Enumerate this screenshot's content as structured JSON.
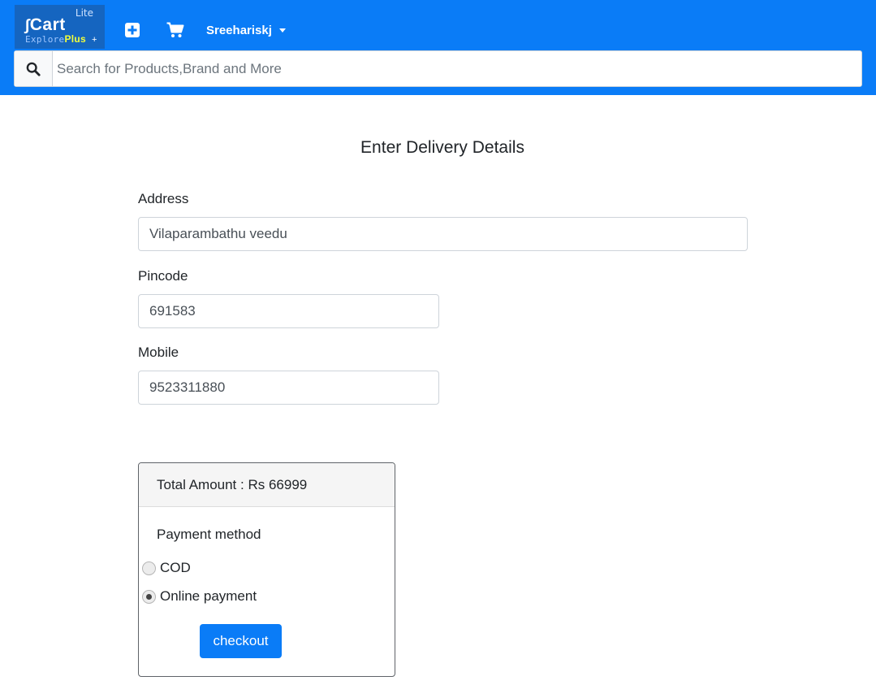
{
  "brand": {
    "name": "Cart",
    "badge": "Lite",
    "tagline_prefix": "Explore",
    "tagline_plus": "Plus",
    "tagline_suffix": "+"
  },
  "navbar": {
    "user_name": "Sreehariskj",
    "icons": [
      "plus-square-icon",
      "shopping-cart-icon",
      "chevron-down-icon"
    ]
  },
  "search": {
    "placeholder": "Search for Products,Brand and More",
    "value": "",
    "icon": "search-icon"
  },
  "form": {
    "title": "Enter Delivery Details",
    "address_label": "Address",
    "address_value": "Vilaparambathu veedu",
    "pincode_label": "Pincode",
    "pincode_value": "691583",
    "mobile_label": "Mobile",
    "mobile_value": "9523311880"
  },
  "summary": {
    "total_text": "Total Amount : Rs 66999",
    "payment_heading": "Payment method",
    "options": [
      {
        "label": "COD",
        "selected": false
      },
      {
        "label": "Online payment",
        "selected": true
      }
    ],
    "checkout_label": "checkout"
  },
  "colors": {
    "primary": "#0a7cf7",
    "logo_bg": "#1565c0",
    "logo_plus": "#f3ff3a"
  }
}
